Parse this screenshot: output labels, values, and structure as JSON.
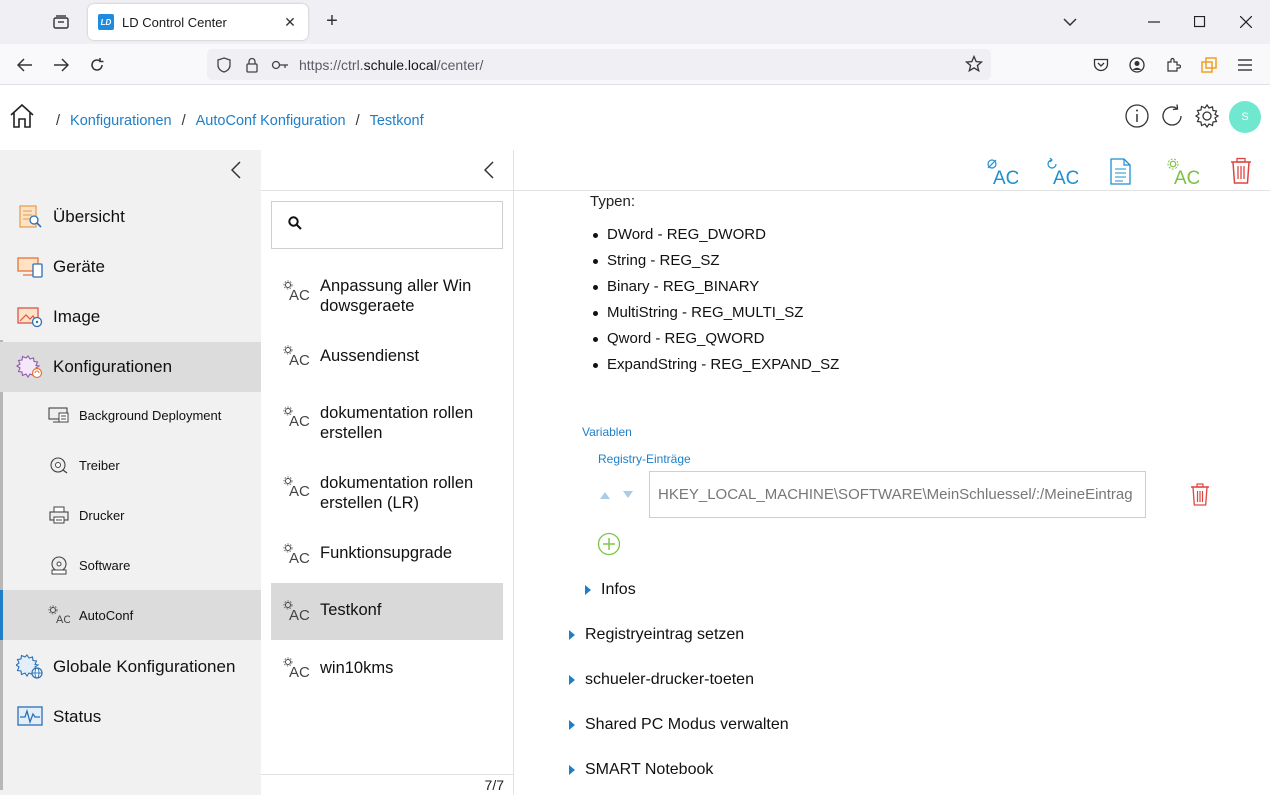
{
  "browser": {
    "tab_title": "LD Control Center",
    "favicon_text": "LD",
    "url_prefix": "https://ctrl.",
    "url_domain": "schule.local",
    "url_path": "/center/"
  },
  "header": {
    "breadcrumbs": [
      "Konfigurationen",
      "AutoConf Konfiguration",
      "Testkonf"
    ],
    "separator": "/",
    "avatar_initial": "S"
  },
  "sidebar": {
    "items": [
      {
        "label": "Übersicht",
        "icon": "overview-icon"
      },
      {
        "label": "Geräte",
        "icon": "devices-icon"
      },
      {
        "label": "Image",
        "icon": "image-icon"
      },
      {
        "label": "Konfigurationen",
        "icon": "config-gear-icon"
      }
    ],
    "sub_items": [
      {
        "label": "Background Deployment",
        "icon": "background-deployment-icon"
      },
      {
        "label": "Treiber",
        "icon": "driver-icon"
      },
      {
        "label": "Drucker",
        "icon": "printer-icon"
      },
      {
        "label": "Software",
        "icon": "software-icon"
      },
      {
        "label": "AutoConf",
        "icon": "autoconf-icon"
      }
    ],
    "bottom_items": [
      {
        "label": "Globale Konfigurationen",
        "icon": "global-config-icon"
      },
      {
        "label": "Status",
        "icon": "status-icon"
      }
    ]
  },
  "list": {
    "search_placeholder": "",
    "items": [
      {
        "label": "Anpassung aller Win dowsgeraete"
      },
      {
        "label": "Aussendienst"
      },
      {
        "label": "dokumentation rollen erstellen"
      },
      {
        "label": "dokumentation rollen erstellen (LR)"
      },
      {
        "label": "Funktionsupgrade"
      },
      {
        "label": "Testkonf"
      },
      {
        "label": "win10kms"
      }
    ],
    "count": "7/7",
    "selected": "Testkonf"
  },
  "main": {
    "toolbar_icon_text": "AC",
    "typen_title": "Typen:",
    "types": [
      "DWord - REG_DWORD",
      "String - REG_SZ",
      "Binary - REG_BINARY",
      "MultiString - REG_MULTI_SZ",
      "Qword - REG_QWORD",
      "ExpandString - REG_EXPAND_SZ"
    ],
    "variables_label": "Variablen",
    "registry_label": "Registry-Einträge",
    "registry_value": "HKEY_LOCAL_MACHINE\\SOFTWARE\\MeinSchluessel/:/MeineEintrag",
    "infos_label": "Infos",
    "sections": [
      "Registryeintrag setzen",
      "schueler-drucker-toeten",
      "Shared PC Modus verwalten",
      "SMART Notebook"
    ]
  },
  "colors": {
    "accent": "#1e7fc8",
    "delete": "#e0443e",
    "add": "#7cc242",
    "avatar": "#6fe8cf",
    "sidebar_bg": "#f1f1f1",
    "active_bg": "#dcdcdc"
  }
}
